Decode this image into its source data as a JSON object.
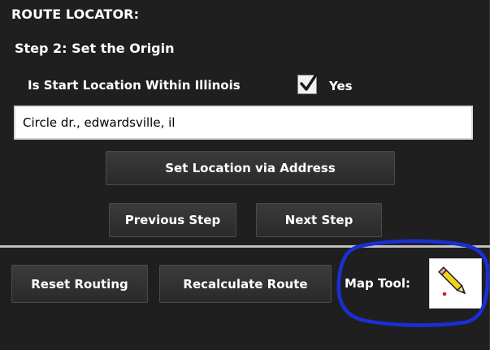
{
  "panel": {
    "title": "ROUTE LOCATOR:",
    "step_label": "Step 2:  Set the Origin"
  },
  "origin": {
    "within_illinois_label": "Is Start Location Within Illinois",
    "within_illinois_checked": true,
    "yes_label": "Yes",
    "address_value": "Circle dr., edwardsville, il"
  },
  "buttons": {
    "set_location": "Set Location via Address",
    "previous_step": "Previous Step",
    "next_step": "Next Step",
    "reset_routing": "Reset Routing",
    "recalculate_route": "Recalculate Route"
  },
  "map_tool": {
    "label": "Map Tool:",
    "icon": "pencil-icon"
  },
  "colors": {
    "panel_background": "#1f1f1f",
    "button_background": "#333333",
    "divider": "#bfbfbf",
    "annotation": "#1a2fd6",
    "pencil_body": "#f2d31b",
    "pencil_tip_dot": "#e01919"
  }
}
